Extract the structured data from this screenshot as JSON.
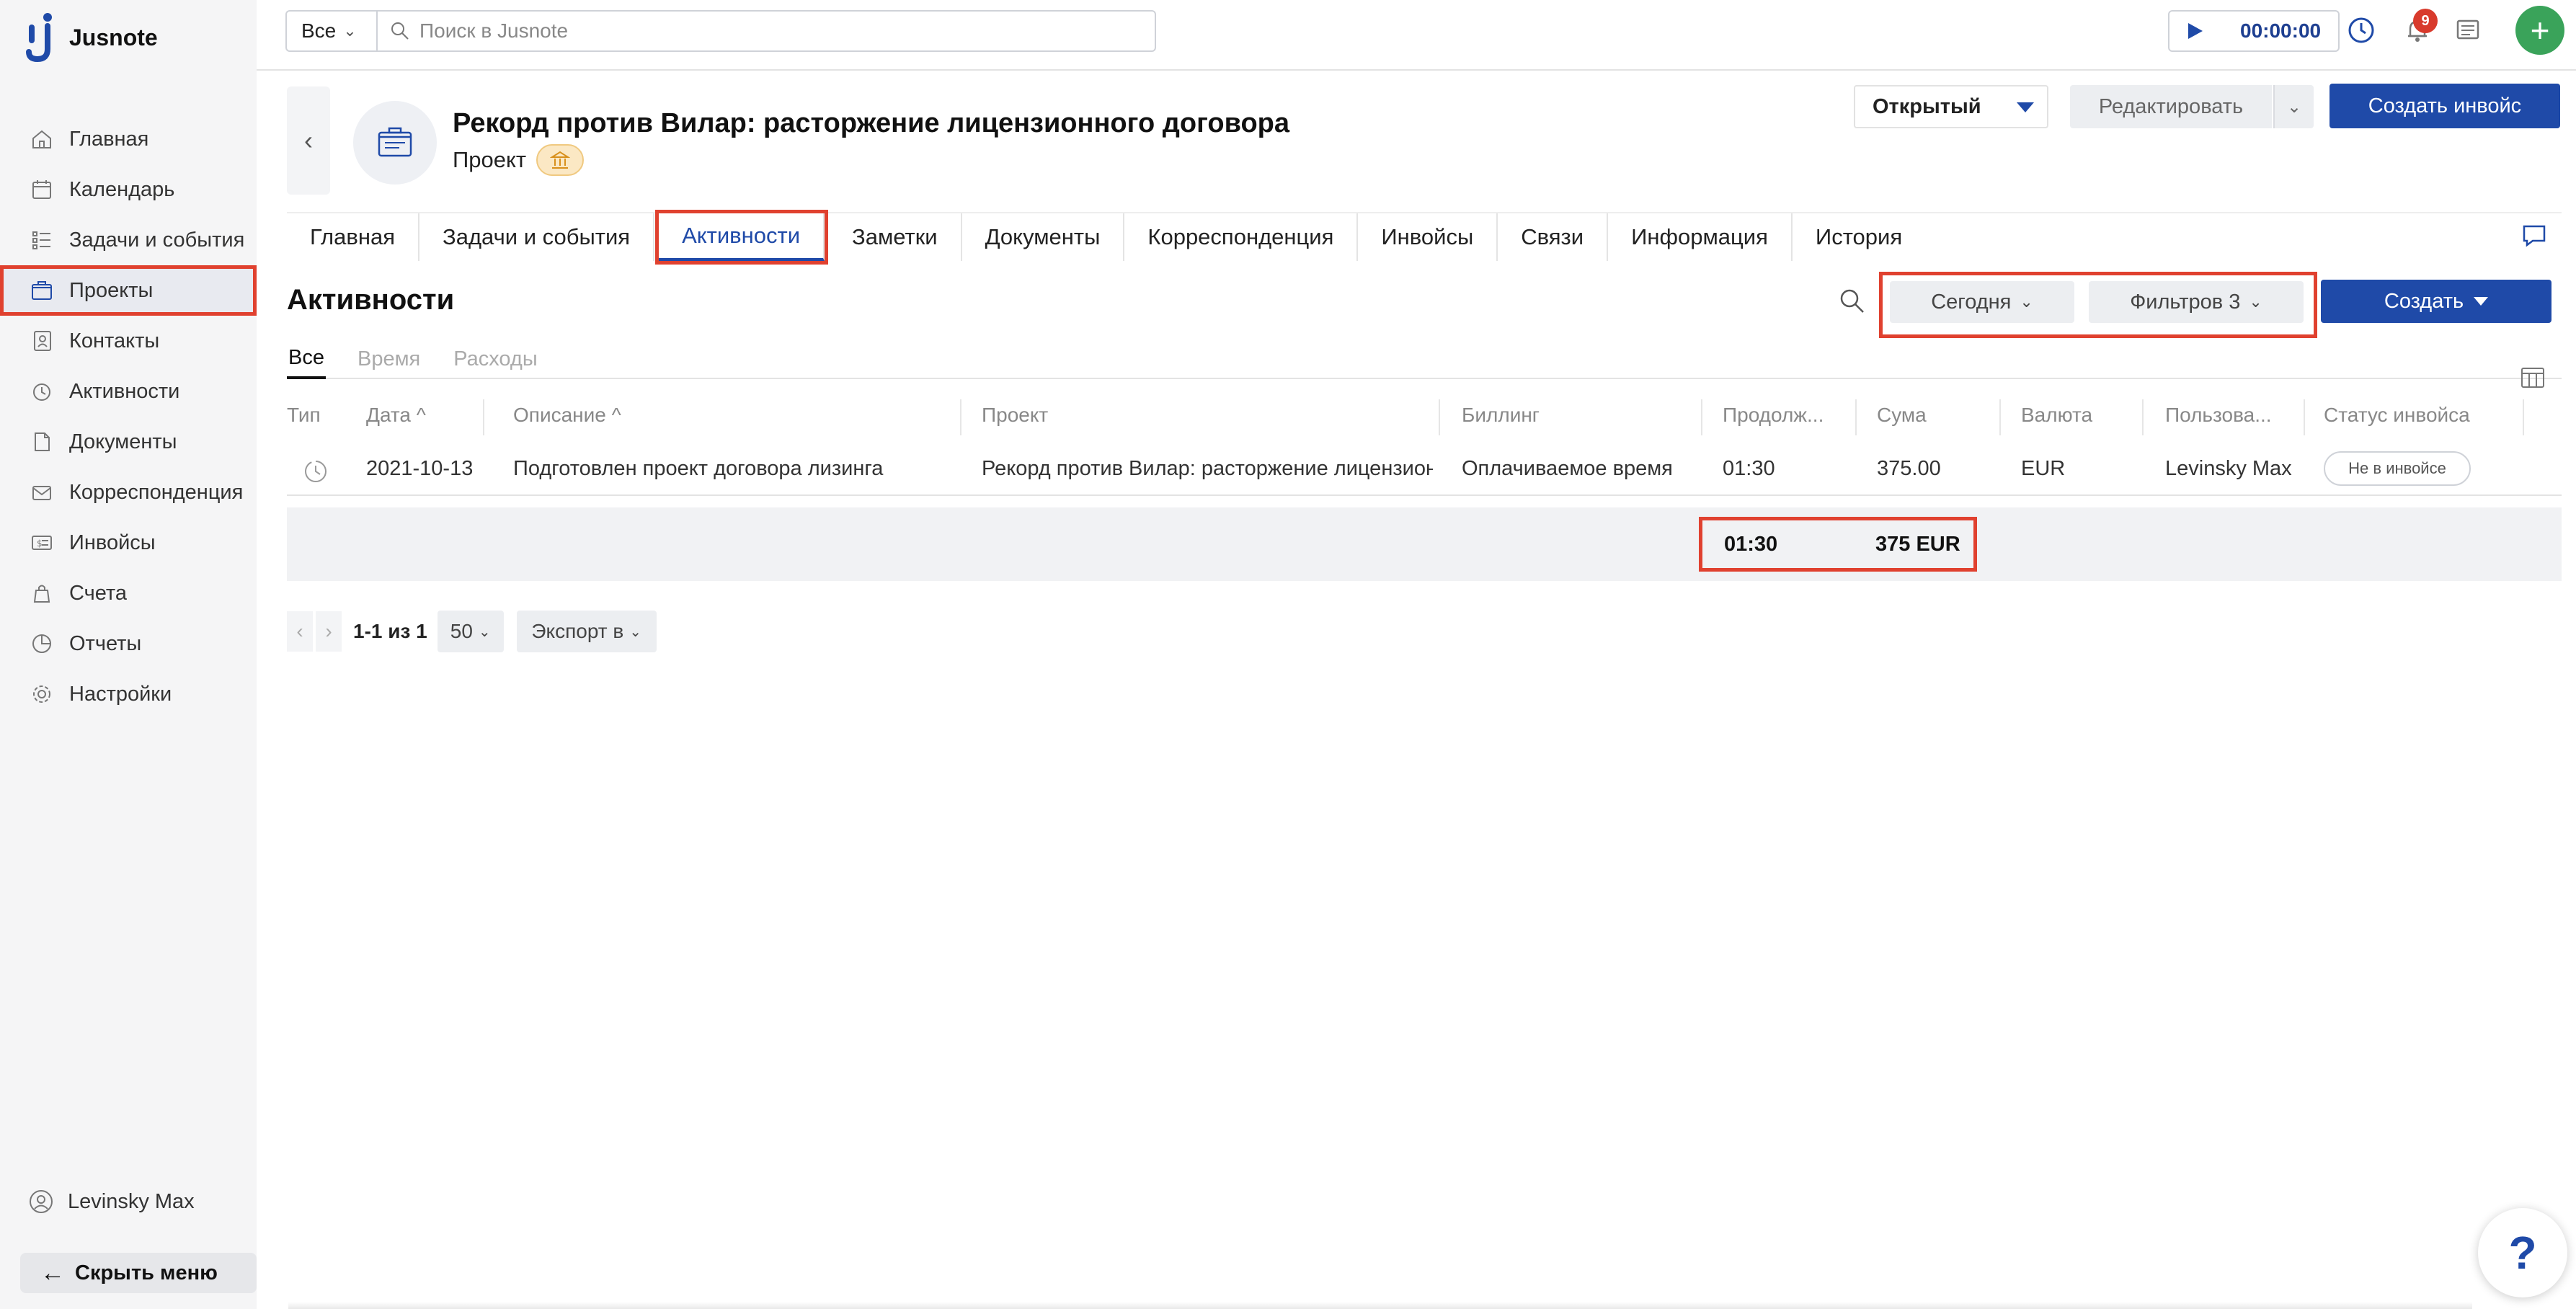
{
  "app": {
    "name": "Jusnote"
  },
  "sidebar": {
    "items": [
      {
        "label": "Главная",
        "icon": "home-icon"
      },
      {
        "label": "Календарь",
        "icon": "calendar-icon"
      },
      {
        "label": "Задачи и события",
        "icon": "tasks-icon"
      },
      {
        "label": "Проекты",
        "icon": "projects-icon",
        "active": true
      },
      {
        "label": "Контакты",
        "icon": "contacts-icon"
      },
      {
        "label": "Активности",
        "icon": "activities-icon"
      },
      {
        "label": "Документы",
        "icon": "documents-icon"
      },
      {
        "label": "Корреспонденция",
        "icon": "correspondence-icon"
      },
      {
        "label": "Инвойсы",
        "icon": "invoices-icon"
      },
      {
        "label": "Счета",
        "icon": "accounts-icon"
      },
      {
        "label": "Отчеты",
        "icon": "reports-icon"
      },
      {
        "label": "Настройки",
        "icon": "settings-icon"
      }
    ],
    "user": "Levinsky Max",
    "hide_menu": "Скрыть меню"
  },
  "topbar": {
    "search_scope": "Все",
    "search_placeholder": "Поиск в Jusnote",
    "timer": "00:00:00",
    "notifications_count": "9"
  },
  "project": {
    "title": "Рекорд против Вилар: расторжение лицензионного договора",
    "subtitle": "Проект",
    "status": "Открытый",
    "edit_label": "Редактировать",
    "create_invoice_label": "Создать инвойс"
  },
  "tabs": [
    {
      "label": "Главная"
    },
    {
      "label": "Задачи и события"
    },
    {
      "label": "Активности",
      "active": true
    },
    {
      "label": "Заметки"
    },
    {
      "label": "Документы"
    },
    {
      "label": "Корреспонденция"
    },
    {
      "label": "Инвойсы"
    },
    {
      "label": "Связи"
    },
    {
      "label": "Информация"
    },
    {
      "label": "История"
    }
  ],
  "section": {
    "title": "Активности",
    "period_filter": "Сегодня",
    "filters_label": "Фильтров 3",
    "create_label": "Создать"
  },
  "subtabs": [
    "Все",
    "Время",
    "Расходы"
  ],
  "table": {
    "headers": [
      "Тип",
      "Дата",
      "Описание",
      "Проект",
      "Биллинг",
      "Продолж...",
      "Сума",
      "Валюта",
      "Пользова...",
      "Статус инвойса"
    ],
    "rows": [
      {
        "date": "2021-10-13",
        "description": "Подготовлен проект договора лизинга",
        "project": "Рекорд против Вилар: расторжение лицензионного договора",
        "billing": "Оплачиваемое время",
        "duration": "01:30",
        "amount": "375.00",
        "currency": "EUR",
        "user": "Levinsky Max",
        "invoice_status": "Не в инвойсе"
      }
    ],
    "totals": {
      "duration": "01:30",
      "amount": "375 EUR"
    }
  },
  "pagination": {
    "info": "1-1 из 1",
    "page_size": "50",
    "export_label": "Экспорт в"
  },
  "help": "?",
  "colors": {
    "primary": "#1f4aa8",
    "highlight": "#e0412f",
    "add": "#3aa35a"
  }
}
